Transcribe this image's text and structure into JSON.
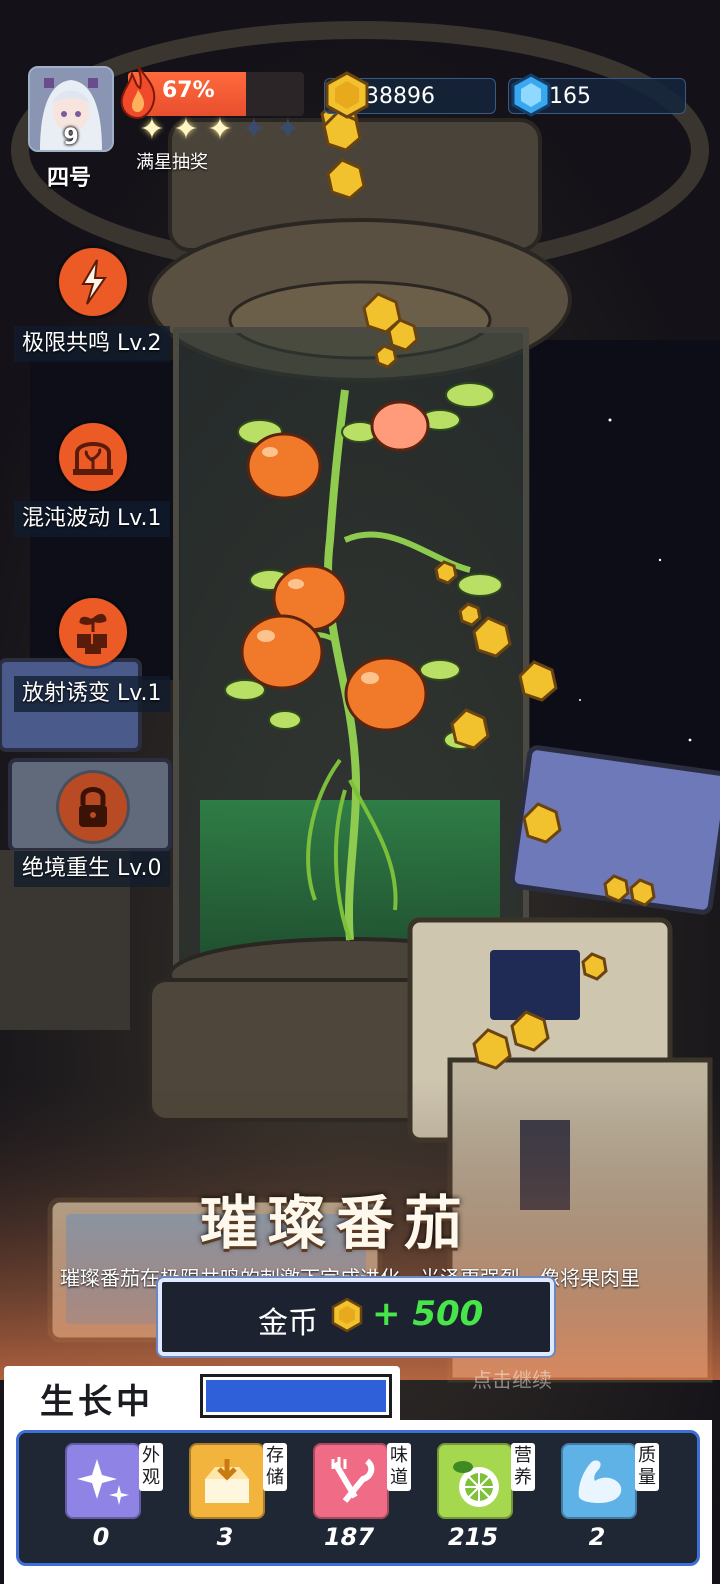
{
  "player": {
    "level": "9",
    "name": "四号"
  },
  "energy": {
    "percent_text": "67%",
    "percent": 67
  },
  "stars": {
    "filled": 3,
    "total": 5,
    "label": "满星抽奖"
  },
  "resources": {
    "gold": "38896",
    "gems": "165"
  },
  "skills": [
    {
      "label": "极限共鸣 Lv.2",
      "icon": "lightning-leaf-icon",
      "locked": false
    },
    {
      "label": "混沌波动 Lv.1",
      "icon": "plant-dome-icon",
      "locked": false
    },
    {
      "label": "放射诱变 Lv.1",
      "icon": "sprout-boxes-icon",
      "locked": false
    },
    {
      "label": "绝境重生 Lv.0",
      "icon": "lock-icon",
      "locked": true
    }
  ],
  "evolution": {
    "title": "璀璨番茄",
    "description": "璀璨番茄在极限共鸣的刺激下完成进化，光泽更强烈，像将果肉里"
  },
  "reward": {
    "label": "金币",
    "amount": "+ 500"
  },
  "continue_hint": "点击继续",
  "growth": {
    "status": "生长中",
    "progress": 1.0
  },
  "stats": [
    {
      "tag": "外观",
      "value": "0",
      "icon": "sparkle-icon",
      "color": "#8f84e6"
    },
    {
      "tag": "存储",
      "value": "3",
      "icon": "storage-box-icon",
      "color": "#f2b43c"
    },
    {
      "tag": "味道",
      "value": "187",
      "icon": "fork-spoon-icon",
      "color": "#f06b86"
    },
    {
      "tag": "营养",
      "value": "215",
      "icon": "lime-icon",
      "color": "#a6d84f"
    },
    {
      "tag": "质量",
      "value": "2",
      "icon": "muscle-arm-icon",
      "color": "#5fb2e6"
    }
  ],
  "colors": {
    "accent_orange": "#ec5a26",
    "gold": "#f2c12e",
    "reward_green": "#46e64a",
    "progress_blue": "#2f5fd9"
  }
}
